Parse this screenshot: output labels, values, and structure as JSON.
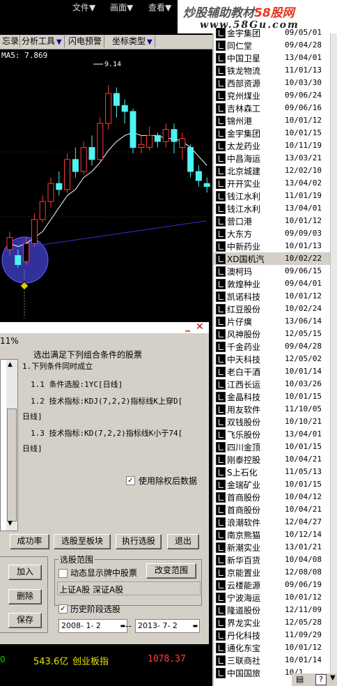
{
  "menu": {
    "items": [
      "文件",
      "画面",
      "查看"
    ]
  },
  "watermark": {
    "line1a": "炒股辅助教材",
    "line1b": "58股网",
    "line2": "www.58Gu.com"
  },
  "toolbar": {
    "items": [
      "忘录",
      "分析工具",
      "闪电预警",
      "坐标类型"
    ]
  },
  "chart": {
    "ma_label": "MA5: 7.869",
    "high_label": "9.14",
    "colors": {
      "up": "#ff3b3b",
      "down": "#4ef3f3",
      "ma5": "#ffffff",
      "ma10": "#e6e600",
      "ma20": "#3333cc",
      "highlight": "#3a3ab8"
    }
  },
  "chart_data": {
    "type": "candlestick",
    "candles_description": "Daily candles from left to right",
    "candles": [
      {
        "o": 6.4,
        "c": 6.6,
        "h": 6.7,
        "l": 6.3
      },
      {
        "o": 6.3,
        "c": 6.15,
        "h": 6.4,
        "l": 6.1
      },
      {
        "o": 6.2,
        "c": 6.5,
        "h": 6.6,
        "l": 6.15
      },
      {
        "o": 6.5,
        "c": 6.9,
        "h": 7.0,
        "l": 6.45
      },
      {
        "o": 6.9,
        "c": 7.2,
        "h": 7.3,
        "l": 6.85
      },
      {
        "o": 7.2,
        "c": 7.5,
        "h": 7.6,
        "l": 7.1
      },
      {
        "o": 7.5,
        "c": 7.4,
        "h": 7.7,
        "l": 7.3
      },
      {
        "o": 7.4,
        "c": 7.9,
        "h": 8.0,
        "l": 7.35
      },
      {
        "o": 7.9,
        "c": 7.7,
        "h": 8.1,
        "l": 7.6
      },
      {
        "o": 7.7,
        "c": 8.1,
        "h": 8.2,
        "l": 7.65
      },
      {
        "o": 8.1,
        "c": 7.9,
        "h": 8.3,
        "l": 7.8
      },
      {
        "o": 7.9,
        "c": 8.5,
        "h": 8.6,
        "l": 7.85
      },
      {
        "o": 8.5,
        "c": 9.0,
        "h": 9.14,
        "l": 8.4
      },
      {
        "o": 9.0,
        "c": 8.8,
        "h": 9.1,
        "l": 8.6
      },
      {
        "o": 8.8,
        "c": 8.7,
        "h": 8.9,
        "l": 8.5
      },
      {
        "o": 8.7,
        "c": 8.1,
        "h": 8.75,
        "l": 8.0
      },
      {
        "o": 8.1,
        "c": 8.15,
        "h": 8.3,
        "l": 8.0
      },
      {
        "o": 8.1,
        "c": 8.3,
        "h": 8.45,
        "l": 8.05
      },
      {
        "o": 8.3,
        "c": 8.2,
        "h": 8.35,
        "l": 8.1
      },
      {
        "o": 8.2,
        "c": 8.4,
        "h": 8.5,
        "l": 8.1
      },
      {
        "o": 8.4,
        "c": 8.2,
        "h": 8.5,
        "l": 8.0
      },
      {
        "o": 8.1,
        "c": 8.25,
        "h": 8.35,
        "l": 7.9
      },
      {
        "o": 8.1,
        "c": 7.7,
        "h": 8.15,
        "l": 7.6
      },
      {
        "o": 7.7,
        "c": 7.55,
        "h": 7.8,
        "l": 7.45
      },
      {
        "o": 7.5,
        "c": 7.45,
        "h": 7.6,
        "l": 7.35
      }
    ],
    "ma5": [
      6.5,
      6.45,
      6.5,
      6.6,
      6.7,
      6.9,
      7.1,
      7.3,
      7.4,
      7.6,
      7.7,
      7.85,
      8.05,
      8.2,
      8.3,
      8.35,
      8.3,
      8.3,
      8.3,
      8.25,
      8.25,
      8.2,
      8.1,
      7.95,
      7.8
    ],
    "ma20": [
      6.4,
      6.42,
      6.44,
      6.46,
      6.48,
      6.5,
      6.52,
      6.54,
      6.56,
      6.58,
      6.6,
      6.62,
      6.64,
      6.66,
      6.68,
      6.7,
      6.72,
      6.74,
      6.76,
      6.78,
      6.8,
      6.82,
      6.84,
      6.86,
      6.88
    ],
    "ylim": [
      5.9,
      9.5
    ]
  },
  "status": {
    "value": "543.6亿",
    "index_name": "创业板指",
    "index_value": "1078.37",
    "zero": "0"
  },
  "dialog": {
    "pct": "11%",
    "header": "选出满足下列组合条件的股票",
    "cond_title": "1.下列条件同时成立",
    "cond1": "1.1  条件选股:1YC[日线]",
    "cond2a": "1.2  技术指标:KDJ(7,2,2)指标线K上穿D[",
    "cond2b": "日线]",
    "cond3a": "1.3  技术指标:KD(7,2,2)指标线K小于74[",
    "cond3b": "日线]",
    "use_adjusted": "使用除权后数据",
    "btn_success": "成功率",
    "btn_to_block": "选股至板块",
    "btn_execute": "执行选股",
    "btn_exit": "退出",
    "btn_add": "加入",
    "btn_delete": "删除",
    "btn_save": "保存",
    "range_title": "选股范围",
    "dynamic_show": "动态显示牌中股票",
    "btn_change_range": "改变范围",
    "markets": "上证A股 深证A股",
    "history": "历史阶段选股",
    "date_from": "2008- 1- 2",
    "date_sep": "--",
    "date_to": "2013- 7- 2"
  },
  "stocks": [
    {
      "name": "金宇集团",
      "date": "09/05/01"
    },
    {
      "name": "同仁堂",
      "date": "09/04/28"
    },
    {
      "name": "中国卫星",
      "date": "13/04/01"
    },
    {
      "name": "铁龙物流",
      "date": "11/01/13"
    },
    {
      "name": "西部资源",
      "date": "10/03/30"
    },
    {
      "name": "兖州煤业",
      "date": "09/06/24"
    },
    {
      "name": "吉林森工",
      "date": "09/06/16"
    },
    {
      "name": "锦州港",
      "date": "10/01/12"
    },
    {
      "name": "金宇集团",
      "date": "10/01/15"
    },
    {
      "name": "太龙药业",
      "date": "10/11/19"
    },
    {
      "name": "中昌海运",
      "date": "13/03/21"
    },
    {
      "name": "北京城建",
      "date": "12/02/10"
    },
    {
      "name": "开开实业",
      "date": "13/04/02"
    },
    {
      "name": "钱江水利",
      "date": "11/01/19"
    },
    {
      "name": "钱江水利",
      "date": "13/04/01"
    },
    {
      "name": "营口港",
      "date": "10/01/12"
    },
    {
      "name": "大东方",
      "date": "09/09/03"
    },
    {
      "name": "中新药业",
      "date": "10/01/13"
    },
    {
      "name": "XD国机汽",
      "date": "10/02/22"
    },
    {
      "name": "澳柯玛",
      "date": "09/06/15"
    },
    {
      "name": "敦煌种业",
      "date": "09/04/01"
    },
    {
      "name": "凯诺科技",
      "date": "10/01/12"
    },
    {
      "name": "红豆股份",
      "date": "10/02/24"
    },
    {
      "name": "片仔癀",
      "date": "13/06/14"
    },
    {
      "name": "风神股份",
      "date": "12/05/15"
    },
    {
      "name": "千金药业",
      "date": "09/04/28"
    },
    {
      "name": "中天科技",
      "date": "12/05/02"
    },
    {
      "name": "老白干酒",
      "date": "10/01/14"
    },
    {
      "name": "江西长运",
      "date": "10/03/26"
    },
    {
      "name": "金晶科技",
      "date": "10/01/15"
    },
    {
      "name": "用友软件",
      "date": "11/10/05"
    },
    {
      "name": "双钱股份",
      "date": "10/10/21"
    },
    {
      "name": "飞乐股份",
      "date": "13/04/01"
    },
    {
      "name": "四川金顶",
      "date": "10/01/15"
    },
    {
      "name": "刚泰控股",
      "date": "10/04/21"
    },
    {
      "name": "S上石化",
      "date": "11/05/13"
    },
    {
      "name": "金瑞矿业",
      "date": "10/01/15"
    },
    {
      "name": "首商股份",
      "date": "10/04/12"
    },
    {
      "name": "首商股份",
      "date": "10/04/21"
    },
    {
      "name": "浪潮软件",
      "date": "12/04/27"
    },
    {
      "name": "南京熊猫",
      "date": "10/12/14"
    },
    {
      "name": "新潮实业",
      "date": "13/01/21"
    },
    {
      "name": "新华百货",
      "date": "10/04/08"
    },
    {
      "name": "京能置业",
      "date": "12/08/08"
    },
    {
      "name": "云楼能源",
      "date": "09/06/19"
    },
    {
      "name": "宁波海运",
      "date": "10/01/12"
    },
    {
      "name": "隆道股份",
      "date": "12/11/09"
    },
    {
      "name": "界龙实业",
      "date": "12/05/28"
    },
    {
      "name": "丹化科技",
      "date": "11/09/29"
    },
    {
      "name": "通化东宝",
      "date": "10/01/12"
    },
    {
      "name": "三联商社",
      "date": "10/01/14"
    },
    {
      "name": "中国国旅",
      "date": "10/1"
    }
  ],
  "selected_index": 18
}
